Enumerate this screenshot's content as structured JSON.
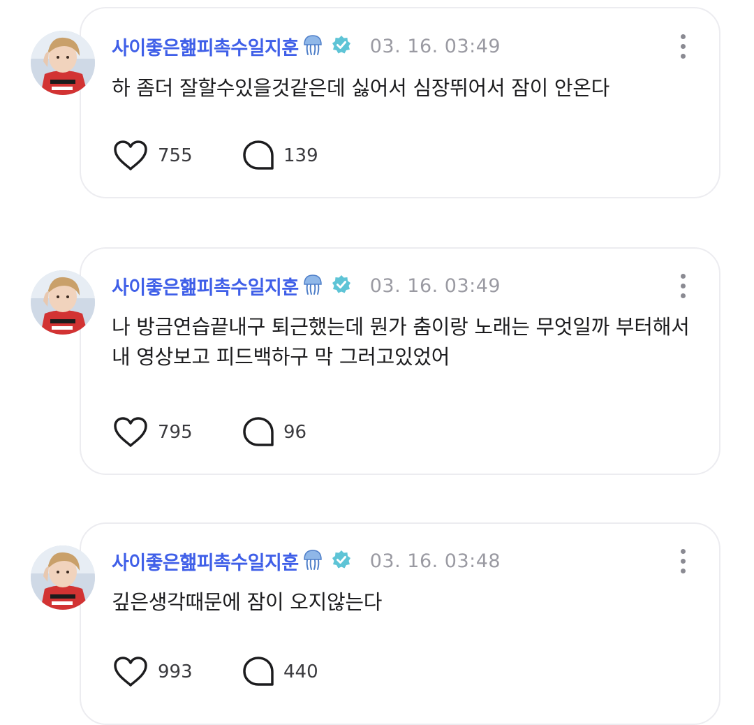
{
  "posts": [
    {
      "username": "사이좋은햂피촉수일지훈",
      "emoji": "jellyfish-icon",
      "verified_icon": "verified-badge-icon",
      "timestamp": "03. 16. 03:49",
      "text": "하 좀더 잘할수있을것같은데 싫어서 심장뛰어서 잠이 안온다",
      "likes": "755",
      "comments": "139"
    },
    {
      "username": "사이좋은햂피촉수일지훈",
      "emoji": "jellyfish-icon",
      "verified_icon": "verified-badge-icon",
      "timestamp": "03. 16. 03:49",
      "text": "나 방금연습끝내구 퇴근했는데 뭔가 춤이랑 노래는 무엇일까 부터해서 내 영상보고 피드백하구 막 그러고있었어",
      "likes": "795",
      "comments": "96"
    },
    {
      "username": "사이좋은햂피촉수일지훈",
      "emoji": "jellyfish-icon",
      "verified_icon": "verified-badge-icon",
      "timestamp": "03. 16. 03:48",
      "text": "깊은생각때문에 잠이 오지않는다",
      "likes": "993",
      "comments": "440"
    }
  ],
  "colors": {
    "username": "#3f5fe8",
    "timestamp": "#9a9aa2",
    "verified": "#5ec4d6",
    "card_border": "#ececf0"
  },
  "icons": {
    "like": "heart-outline-icon",
    "comment": "speech-bubble-icon",
    "more": "more-vertical-icon"
  }
}
